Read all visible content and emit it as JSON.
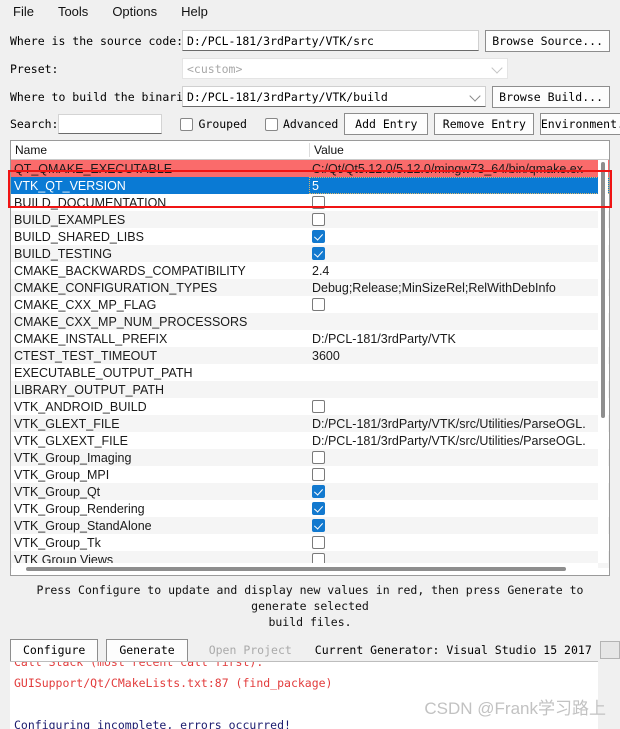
{
  "menu": {
    "items": [
      {
        "label": "File"
      },
      {
        "label": "Tools"
      },
      {
        "label": "Options"
      },
      {
        "label": "Help"
      }
    ]
  },
  "form": {
    "source_label": "Where is the source code:",
    "source_value": "D:/PCL-181/3rdParty/VTK/src",
    "browse_source_label": "Browse Source...",
    "preset_label": "Preset:",
    "preset_value": "<custom>",
    "binaries_label": "Where to build the binaries:",
    "binaries_value": "D:/PCL-181/3rdParty/VTK/build",
    "browse_build_label": "Browse Build...",
    "search_label": "Search:",
    "search_value": "",
    "search_placeholder": "",
    "grouped_label": "Grouped",
    "grouped_checked": false,
    "advanced_label": "Advanced",
    "advanced_checked": false,
    "add_entry_label": "Add Entry",
    "remove_entry_label": "Remove Entry",
    "environment_label": "Environment..."
  },
  "table": {
    "columns": [
      "Name",
      "Value"
    ],
    "rows": [
      {
        "name": "QT_QMAKE_EXECUTABLE",
        "value": "C:/Qt/Qt5.12.0/5.12.0/mingw73_64/bin/qmake.ex",
        "type": "text",
        "state": "red"
      },
      {
        "name": "VTK_QT_VERSION",
        "value": "5",
        "type": "text",
        "state": "selected"
      },
      {
        "name": "BUILD_DOCUMENTATION",
        "value": "",
        "type": "checkbox",
        "checked": false,
        "state": "normal"
      },
      {
        "name": "BUILD_EXAMPLES",
        "value": "",
        "type": "checkbox",
        "checked": false,
        "state": "alt"
      },
      {
        "name": "BUILD_SHARED_LIBS",
        "value": "",
        "type": "checkbox",
        "checked": true,
        "state": "normal"
      },
      {
        "name": "BUILD_TESTING",
        "value": "",
        "type": "checkbox",
        "checked": true,
        "state": "alt"
      },
      {
        "name": "CMAKE_BACKWARDS_COMPATIBILITY",
        "value": "2.4",
        "type": "text",
        "state": "normal"
      },
      {
        "name": "CMAKE_CONFIGURATION_TYPES",
        "value": "Debug;Release;MinSizeRel;RelWithDebInfo",
        "type": "text",
        "state": "alt"
      },
      {
        "name": "CMAKE_CXX_MP_FLAG",
        "value": "",
        "type": "checkbox",
        "checked": false,
        "state": "normal"
      },
      {
        "name": "CMAKE_CXX_MP_NUM_PROCESSORS",
        "value": "",
        "type": "text",
        "state": "alt"
      },
      {
        "name": "CMAKE_INSTALL_PREFIX",
        "value": "D:/PCL-181/3rdParty/VTK",
        "type": "text",
        "state": "normal"
      },
      {
        "name": "CTEST_TEST_TIMEOUT",
        "value": "3600",
        "type": "text",
        "state": "alt"
      },
      {
        "name": "EXECUTABLE_OUTPUT_PATH",
        "value": "",
        "type": "text",
        "state": "normal"
      },
      {
        "name": "LIBRARY_OUTPUT_PATH",
        "value": "",
        "type": "text",
        "state": "alt"
      },
      {
        "name": "VTK_ANDROID_BUILD",
        "value": "",
        "type": "checkbox",
        "checked": false,
        "state": "normal"
      },
      {
        "name": "VTK_GLEXT_FILE",
        "value": "D:/PCL-181/3rdParty/VTK/src/Utilities/ParseOGL.",
        "type": "text",
        "state": "alt"
      },
      {
        "name": "VTK_GLXEXT_FILE",
        "value": "D:/PCL-181/3rdParty/VTK/src/Utilities/ParseOGL.",
        "type": "text",
        "state": "normal"
      },
      {
        "name": "VTK_Group_Imaging",
        "value": "",
        "type": "checkbox",
        "checked": false,
        "state": "alt"
      },
      {
        "name": "VTK_Group_MPI",
        "value": "",
        "type": "checkbox",
        "checked": false,
        "state": "normal"
      },
      {
        "name": "VTK_Group_Qt",
        "value": "",
        "type": "checkbox",
        "checked": true,
        "state": "alt"
      },
      {
        "name": "VTK_Group_Rendering",
        "value": "",
        "type": "checkbox",
        "checked": true,
        "state": "normal"
      },
      {
        "name": "VTK_Group_StandAlone",
        "value": "",
        "type": "checkbox",
        "checked": true,
        "state": "alt"
      },
      {
        "name": "VTK_Group_Tk",
        "value": "",
        "type": "checkbox",
        "checked": false,
        "state": "normal"
      },
      {
        "name": "VTK Group Views",
        "value": "",
        "type": "checkbox",
        "checked": false,
        "state": "alt"
      }
    ]
  },
  "hint": {
    "line1": "Press Configure to update and display new values in red, then press Generate to generate selected",
    "line2": "build files."
  },
  "actions": {
    "configure_label": "Configure",
    "generate_label": "Generate",
    "open_project_label": "Open Project",
    "generator_label": "Current Generator: Visual Studio 15 2017",
    "progress_value": ""
  },
  "log": {
    "lines": [
      {
        "text": "Call Stack (most recent call first):",
        "style": "err-cut"
      },
      {
        "text": "  GUISupport/Qt/CMakeLists.txt:87 (find_package)",
        "style": "err"
      },
      {
        "text": "",
        "style": "err"
      },
      {
        "text": "",
        "style": "err"
      },
      {
        "text": "Configuring incomplete, errors occurred!",
        "style": "final"
      }
    ]
  },
  "watermark": {
    "text": "CSDN @Frank学习路上"
  },
  "colors": {
    "red_highlight": "#fa6b6b",
    "selection_blue": "#0a7ad4",
    "annotation_red": "#f01414",
    "error_text": "#e23c3c",
    "window_bg": "#f0f0f0"
  }
}
